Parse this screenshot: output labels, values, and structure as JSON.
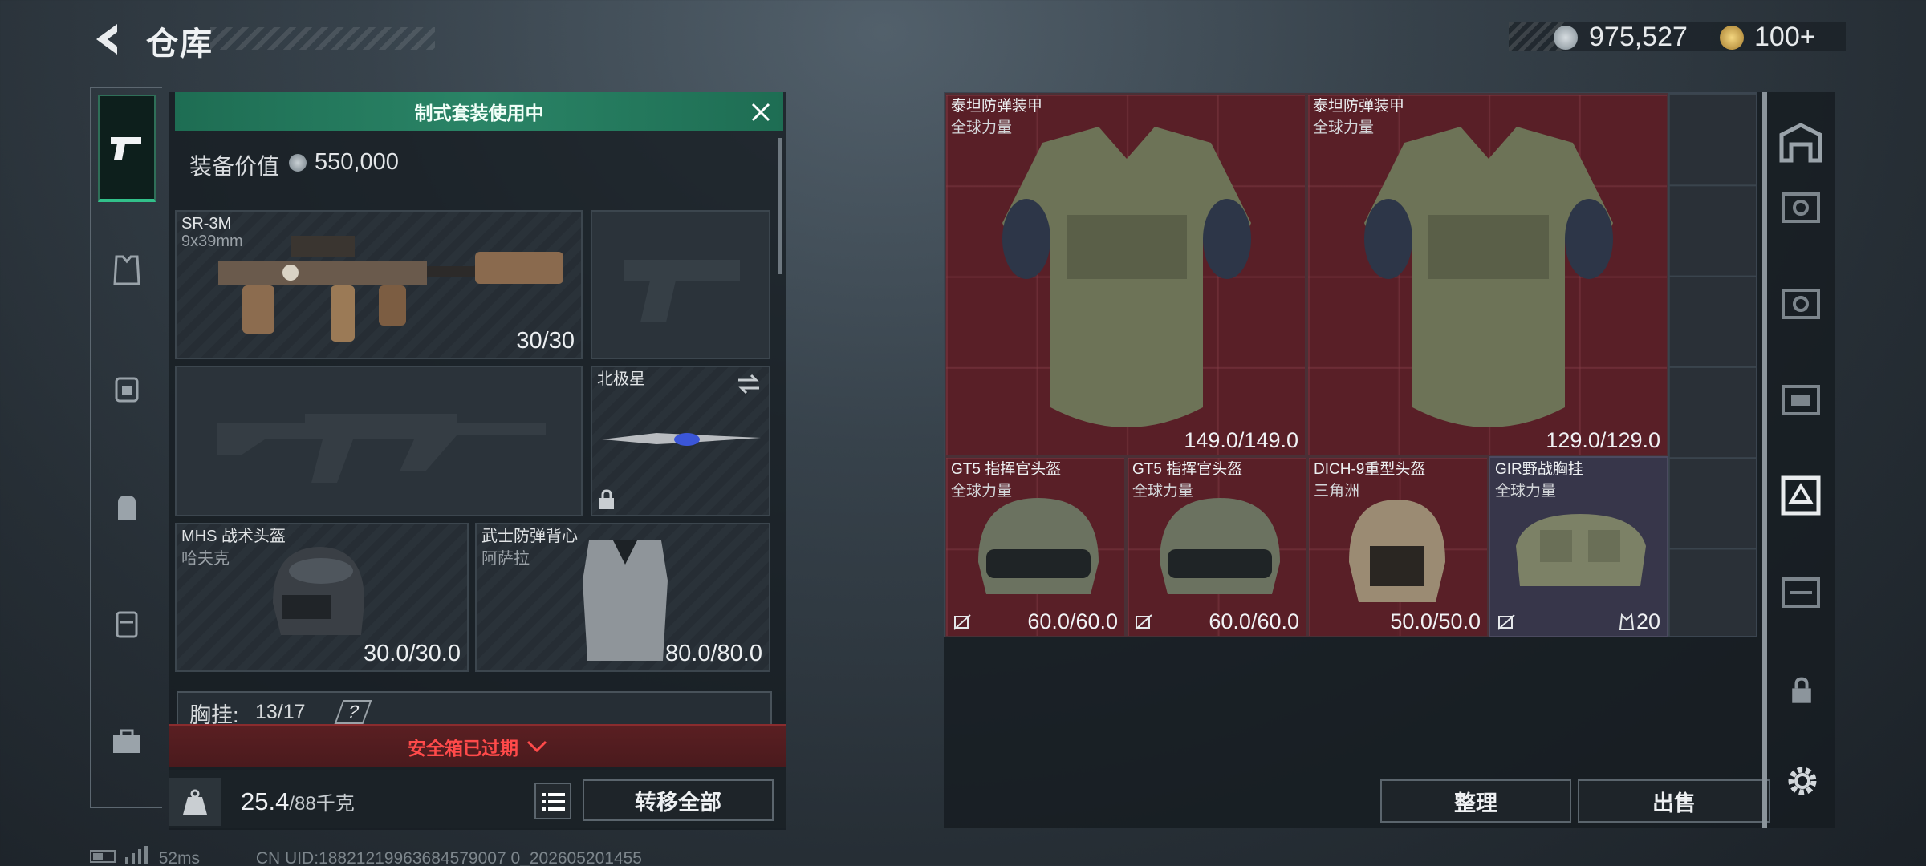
{
  "header": {
    "title": "仓库"
  },
  "currency": [
    {
      "name": "coin",
      "value": "975,527"
    },
    {
      "name": "token",
      "value": "100+"
    }
  ],
  "loadout": {
    "banner": "制式套装使用中",
    "value_label": "装备价值",
    "value": "550,000",
    "slots": {
      "primary": {
        "name": "SR-3M",
        "sub": "9x39mm",
        "value": "30/30"
      },
      "melee": {
        "name": "北极星"
      },
      "helmet": {
        "name": "MHS 战术头盔",
        "sub": "哈夫克",
        "value": "30.0/30.0"
      },
      "armor": {
        "name": "武士防弹背心",
        "sub": "阿萨拉",
        "value": "80.0/80.0"
      }
    },
    "chest_label": "胸挂:",
    "chest_count": "13/17",
    "chest_help": "?",
    "safe_box": "安全箱已过期",
    "weight": "25.4",
    "weight_max": "/88千克",
    "transfer_all": "转移全部"
  },
  "storage": {
    "items": [
      {
        "name": "泰坦防弹装甲",
        "sub": "全球力量",
        "value": "149.0/149.0"
      },
      {
        "name": "泰坦防弹装甲",
        "sub": "全球力量",
        "value": "129.0/129.0"
      },
      {
        "name": "GT5 指挥官头盔",
        "sub": "全球力量",
        "value": "60.0/60.0"
      },
      {
        "name": "GT5 指挥官头盔",
        "sub": "全球力量",
        "value": "60.0/60.0"
      },
      {
        "name": "DICH-9重型头盔",
        "sub": "三角洲",
        "value": "50.0/50.0"
      },
      {
        "name": "GIR野战胸挂",
        "sub": "全球力量",
        "value": "20"
      }
    ],
    "organize": "整理",
    "sell": "出售"
  },
  "status": {
    "ping": "52ms",
    "uid": "CN UID:18821219963684579007 0_202605201455"
  }
}
